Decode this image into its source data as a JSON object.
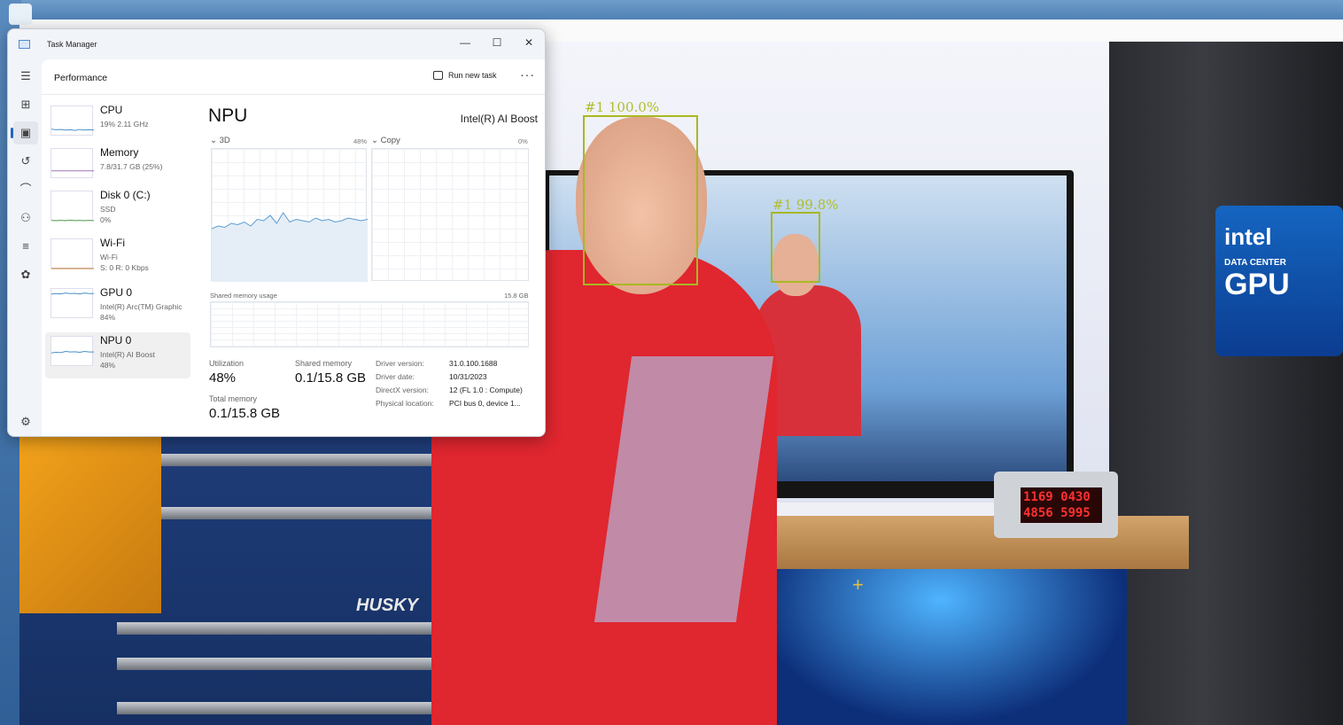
{
  "window": {
    "title": "Task Manager",
    "minimize": "—",
    "maximize": "☐",
    "close": "✕"
  },
  "header": {
    "title": "Performance",
    "run_new_task": "Run new task",
    "more": "···"
  },
  "nav": [
    "menu-icon",
    "processes-icon",
    "performance-icon",
    "app-history-icon",
    "startup-apps-icon",
    "users-icon",
    "details-icon",
    "services-icon",
    "settings-icon"
  ],
  "devices": [
    {
      "name": "CPU",
      "line1": "19%  2.11 GHz",
      "line2": "",
      "color": "#4a90c8",
      "history": [
        22,
        20,
        21,
        19,
        20,
        18,
        21,
        19,
        20,
        19
      ]
    },
    {
      "name": "Memory",
      "line1": "7.8/31.7 GB (25%)",
      "line2": "",
      "color": "#a070b8",
      "history": [
        25,
        25,
        25,
        25,
        25,
        25,
        25,
        25,
        25,
        25
      ]
    },
    {
      "name": "Disk 0 (C:)",
      "line1": "SSD",
      "line2": "0%",
      "color": "#5aa050",
      "history": [
        1,
        0,
        1,
        0,
        2,
        0,
        1,
        0,
        1,
        0
      ]
    },
    {
      "name": "Wi-Fi",
      "line1": "Wi-Fi",
      "line2": "S: 0  R: 0 Kbps",
      "color": "#c07a30",
      "history": [
        0,
        0,
        0,
        0,
        0,
        0,
        0,
        0,
        0,
        0
      ]
    },
    {
      "name": "GPU 0",
      "line1": "Intel(R) Arc(TM) Graphic",
      "line2": "84%",
      "color": "#4a90c8",
      "history": [
        82,
        84,
        83,
        86,
        84,
        85,
        83,
        86,
        84,
        84
      ]
    },
    {
      "name": "NPU 0",
      "line1": "Intel(R) AI Boost",
      "line2": "48%",
      "color": "#4a90c8",
      "history": [
        45,
        47,
        46,
        50,
        48,
        49,
        47,
        50,
        48,
        48
      ]
    }
  ],
  "npu": {
    "title": "NPU",
    "device_name": "Intel(R) AI Boost",
    "graph1_label": "3D",
    "graph1_pct": "48%",
    "graph2_label": "Copy",
    "graph2_pct": "0%",
    "graph1_history": [
      40,
      42,
      41,
      44,
      43,
      45,
      42,
      47,
      46,
      50,
      44,
      52,
      45,
      47,
      46,
      45,
      48,
      46,
      47,
      45,
      46,
      48,
      47,
      46,
      47
    ],
    "shared_label": "Shared memory usage",
    "shared_max": "15.8 GB",
    "utilization_label": "Utilization",
    "utilization": "48%",
    "shared_memory_label": "Shared memory",
    "shared_memory": "0.1/15.8 GB",
    "total_memory_label": "Total memory",
    "total_memory": "0.1/15.8 GB",
    "details": [
      {
        "k": "Driver version:",
        "v": "31.0.100.1688"
      },
      {
        "k": "Driver date:",
        "v": "10/31/2023"
      },
      {
        "k": "DirectX version:",
        "v": "12 (FL 1.0 : Compute)"
      },
      {
        "k": "Physical location:",
        "v": "PCI bus 0, device 1..."
      }
    ]
  },
  "video": {
    "face1_label": "#1  100.0%",
    "face2_label": "#1  99.8%",
    "meter": "1169 0430\n4856 5995",
    "intel_brand": "intel",
    "intel_sub": "DATA CENTER",
    "intel_gpu": "GPU",
    "husky": "HUSKY"
  }
}
